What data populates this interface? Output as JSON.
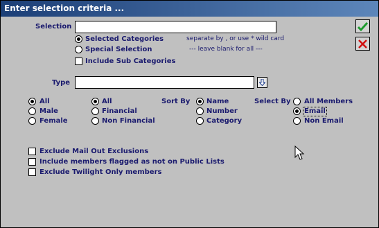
{
  "window": {
    "title": "Enter selection criteria ..."
  },
  "selection": {
    "label": "Selection",
    "value": "",
    "options": [
      {
        "label": "Selected Categories",
        "checked": true
      },
      {
        "label": "Special Selection",
        "checked": false
      }
    ],
    "include_sub_categories": {
      "label": "Include Sub Categories",
      "checked": false
    },
    "hint_wildcard": "separate by , or use * wild card",
    "hint_blank": "---   leave blank for all   ---"
  },
  "type": {
    "label": "Type",
    "value": ""
  },
  "gender": {
    "options": [
      {
        "label": "All",
        "checked": true
      },
      {
        "label": "Male",
        "checked": false
      },
      {
        "label": "Female",
        "checked": false
      }
    ]
  },
  "financial": {
    "options": [
      {
        "label": "All",
        "checked": true
      },
      {
        "label": "Financial",
        "checked": false
      },
      {
        "label": "Non Financial",
        "checked": false
      }
    ]
  },
  "sort_by": {
    "label": "Sort By",
    "options": [
      {
        "label": "Name",
        "checked": true
      },
      {
        "label": "Number",
        "checked": false
      },
      {
        "label": "Category",
        "checked": false
      }
    ]
  },
  "select_by": {
    "label": "Select By",
    "options": [
      {
        "label": "All Members",
        "checked": false
      },
      {
        "label": "Email",
        "checked": true
      },
      {
        "label": "Non Email",
        "checked": false
      }
    ]
  },
  "exclusions": [
    {
      "label": "Exclude Mail Out Exclusions",
      "checked": false
    },
    {
      "label": "Include members flagged as not on Public Lists",
      "checked": false
    },
    {
      "label": "Exclude Twilight Only members",
      "checked": false
    }
  ],
  "icons": {
    "ok": "checkmark-icon",
    "cancel": "x-icon",
    "dropdown": "down-arrow-icon",
    "pointer": "mouse-pointer-icon"
  },
  "colors": {
    "title_bar": "#1c3f77",
    "label_text": "#1a1a6e",
    "ok_green": "#1e9a2e",
    "cancel_red": "#d01010"
  }
}
